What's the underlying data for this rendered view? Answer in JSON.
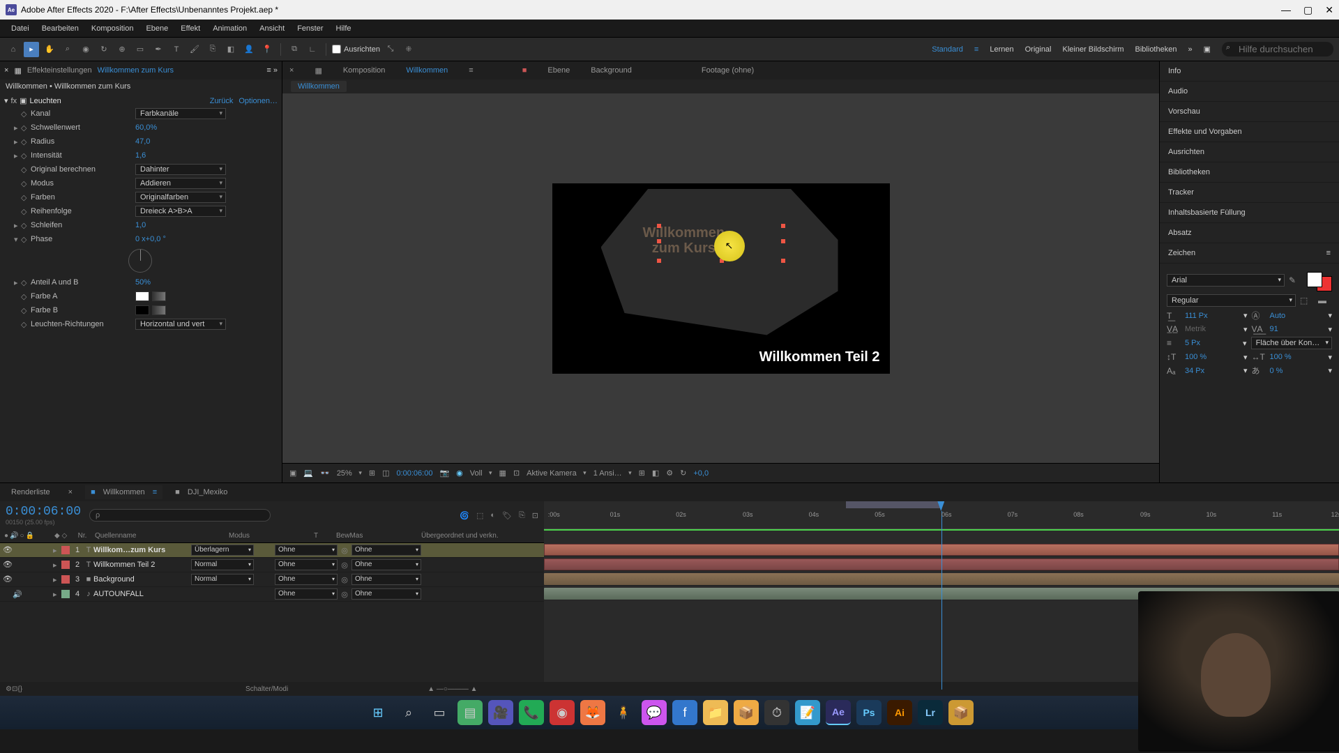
{
  "titlebar": {
    "app": "Ae",
    "title": "Adobe After Effects 2020 - F:\\After Effects\\Unbenanntes Projekt.aep *"
  },
  "menu": [
    "Datei",
    "Bearbeiten",
    "Komposition",
    "Ebene",
    "Effekt",
    "Animation",
    "Ansicht",
    "Fenster",
    "Hilfe"
  ],
  "toolbar": {
    "ausrichten": "Ausrichten",
    "workspaces": [
      "Standard",
      "Lernen",
      "Original",
      "Kleiner Bildschirm",
      "Bibliotheken"
    ],
    "search_placeholder": "Hilfe durchsuchen"
  },
  "effect_tabs": {
    "effekt": "Effekteinstellungen",
    "active_comp": "Willkommen zum Kurs"
  },
  "breadcrumb": "Willkommen • Willkommen zum Kurs",
  "effect": {
    "name": "Leuchten",
    "back": "Zurück",
    "opts": "Optionen…",
    "kanal_label": "Kanal",
    "kanal_val": "Farbkanäle",
    "schwelle_label": "Schwellenwert",
    "schwelle_val": "60,0%",
    "radius_label": "Radius",
    "radius_val": "47,0",
    "intens_label": "Intensität",
    "intens_val": "1,6",
    "orig_label": "Original berechnen",
    "orig_val": "Dahinter",
    "modus_label": "Modus",
    "modus_val": "Addieren",
    "farben_label": "Farben",
    "farben_val": "Originalfarben",
    "reihen_label": "Reihenfolge",
    "reihen_val": "Dreieck A>B>A",
    "schleifen_label": "Schleifen",
    "schleifen_val": "1,0",
    "phase_label": "Phase",
    "phase_val": "0 x+0,0 °",
    "anteil_label": "Anteil A und B",
    "anteil_val": "50%",
    "farbeA_label": "Farbe A",
    "farbeB_label": "Farbe B",
    "richt_label": "Leuchten-Richtungen",
    "richt_val": "Horizontal und vert"
  },
  "comp_tabs": {
    "comp_label": "Komposition",
    "comp_name": "Willkommen",
    "ebene_label": "Ebene",
    "ebene_name": "Background",
    "footage": "Footage (ohne)"
  },
  "comp_crumb": "Willkommen",
  "viewer": {
    "text1_line1": "Willkommen",
    "text1_line2": "zum Kurs",
    "text2": "Willkommen Teil 2"
  },
  "viewer_footer": {
    "zoom": "25%",
    "timecode": "0:00:06:00",
    "voll": "Voll",
    "cam": "Aktive Kamera",
    "views": "1 Ansi…",
    "plus": "+0,0"
  },
  "right_panels": [
    "Info",
    "Audio",
    "Vorschau",
    "Effekte und Vorgaben",
    "Ausrichten",
    "Bibliotheken",
    "Tracker",
    "Inhaltsbasierte Füllung",
    "Absatz"
  ],
  "char": {
    "title": "Zeichen",
    "font": "Arial",
    "style": "Regular",
    "size": "111 Px",
    "leading": "Auto",
    "kern": "Metrik",
    "tracking": "91",
    "stroke": "5 Px",
    "stroke_opt": "Fläche über Kon…",
    "hscale": "100 %",
    "vscale": "100 %",
    "baseline": "34 Px",
    "tsume": "0 %"
  },
  "bottom_tabs": {
    "render": "Renderliste",
    "comp": "Willkommen",
    "other": "DJI_Mexiko"
  },
  "timeline": {
    "timecode": "0:00:06:00",
    "frame_info": "00150 (25.00 fps)",
    "search_placeholder": "ρ",
    "cols": {
      "nr": "Nr.",
      "name": "Quellenname",
      "modus": "Modus",
      "t": "T",
      "bewmas": "BewMas",
      "parent": "Übergeordnet und verkn."
    },
    "ticks": [
      ":00s",
      "01s",
      "02s",
      "03s",
      "04s",
      "05s",
      "06s",
      "07s",
      "08s",
      "09s",
      "10s",
      "11s",
      "12s"
    ],
    "status": "Schalter/Modi"
  },
  "layers": [
    {
      "num": "1",
      "type": "T",
      "name": "Willkom…zum Kurs",
      "mode": "Überlagern",
      "mat": "Ohne",
      "parent": "Ohne",
      "sel": true,
      "color": "#c55"
    },
    {
      "num": "2",
      "type": "T",
      "name": "Willkommen Teil 2",
      "mode": "Normal",
      "mat": "Ohne",
      "parent": "Ohne",
      "sel": false,
      "color": "#c55"
    },
    {
      "num": "3",
      "type": "■",
      "name": "Background",
      "mode": "Normal",
      "mat": "Ohne",
      "parent": "Ohne",
      "sel": false,
      "color": "#c55"
    },
    {
      "num": "4",
      "type": "♪",
      "name": "AUTOUNFALL",
      "mode": "",
      "mat": "Ohne",
      "parent": "Ohne",
      "sel": false,
      "color": "#7a8"
    }
  ],
  "taskbar_apps": [
    "⊞",
    "⌕",
    "▭",
    "▤",
    "🎥",
    "📞",
    "◉",
    "🦊",
    "🧍",
    "💬",
    "f",
    "📁",
    "📦",
    "⏱",
    "📝",
    "Ae",
    "Ps",
    "Ai",
    "Lr",
    "📦"
  ]
}
